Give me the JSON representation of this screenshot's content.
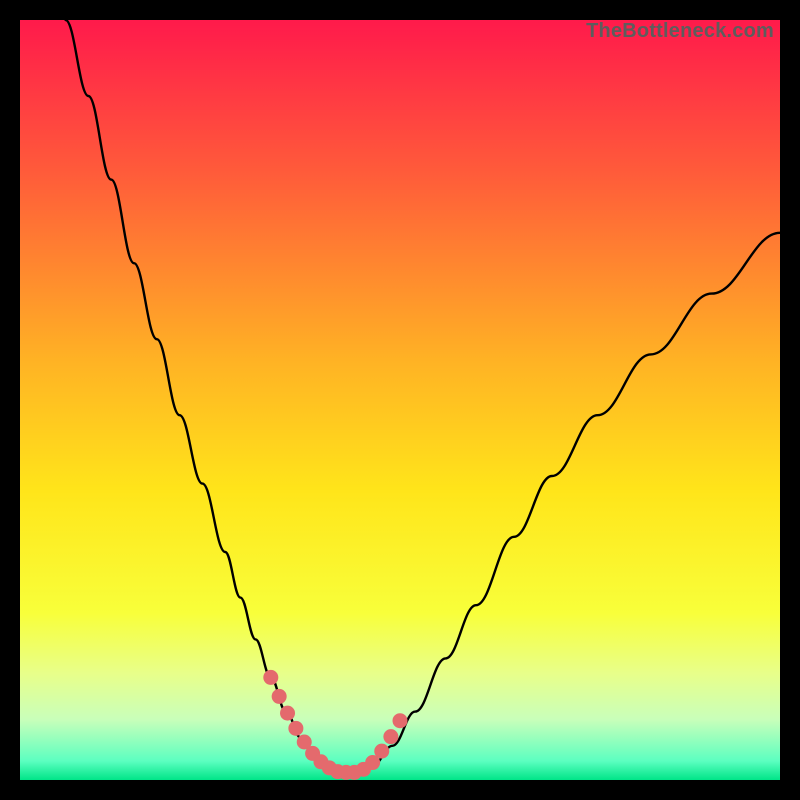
{
  "watermark": "TheBottleneck.com",
  "colors": {
    "frame": "#000000",
    "curve": "#000000",
    "marker": "#e46a6d",
    "gradient_stops": [
      {
        "offset": 0.0,
        "color": "#ff1a4b"
      },
      {
        "offset": 0.2,
        "color": "#ff5b3a"
      },
      {
        "offset": 0.45,
        "color": "#ffb324"
      },
      {
        "offset": 0.62,
        "color": "#ffe51a"
      },
      {
        "offset": 0.78,
        "color": "#f8ff3a"
      },
      {
        "offset": 0.86,
        "color": "#e8ff8a"
      },
      {
        "offset": 0.92,
        "color": "#c9ffba"
      },
      {
        "offset": 0.975,
        "color": "#5cffc0"
      },
      {
        "offset": 1.0,
        "color": "#00e588"
      }
    ]
  },
  "chart_data": {
    "type": "line",
    "title": "",
    "xlabel": "",
    "ylabel": "",
    "xlim": [
      0,
      1
    ],
    "ylim": [
      0,
      1
    ],
    "series": [
      {
        "name": "curve",
        "x": [
          0.06,
          0.09,
          0.12,
          0.15,
          0.18,
          0.21,
          0.24,
          0.27,
          0.29,
          0.31,
          0.33,
          0.35,
          0.37,
          0.385,
          0.4,
          0.42,
          0.44,
          0.465,
          0.49,
          0.52,
          0.56,
          0.6,
          0.65,
          0.7,
          0.76,
          0.83,
          0.91,
          1.0
        ],
        "y": [
          1.0,
          0.9,
          0.79,
          0.68,
          0.58,
          0.48,
          0.39,
          0.3,
          0.24,
          0.185,
          0.135,
          0.09,
          0.055,
          0.035,
          0.02,
          0.01,
          0.01,
          0.02,
          0.045,
          0.09,
          0.16,
          0.23,
          0.32,
          0.4,
          0.48,
          0.56,
          0.64,
          0.72
        ]
      }
    ],
    "markers": {
      "name": "highlight",
      "x": [
        0.33,
        0.341,
        0.352,
        0.363,
        0.374,
        0.385,
        0.396,
        0.407,
        0.418,
        0.429,
        0.44,
        0.452,
        0.464,
        0.476,
        0.488,
        0.5
      ],
      "y": [
        0.135,
        0.11,
        0.088,
        0.068,
        0.05,
        0.035,
        0.024,
        0.016,
        0.011,
        0.01,
        0.01,
        0.014,
        0.023,
        0.038,
        0.057,
        0.078
      ]
    }
  }
}
